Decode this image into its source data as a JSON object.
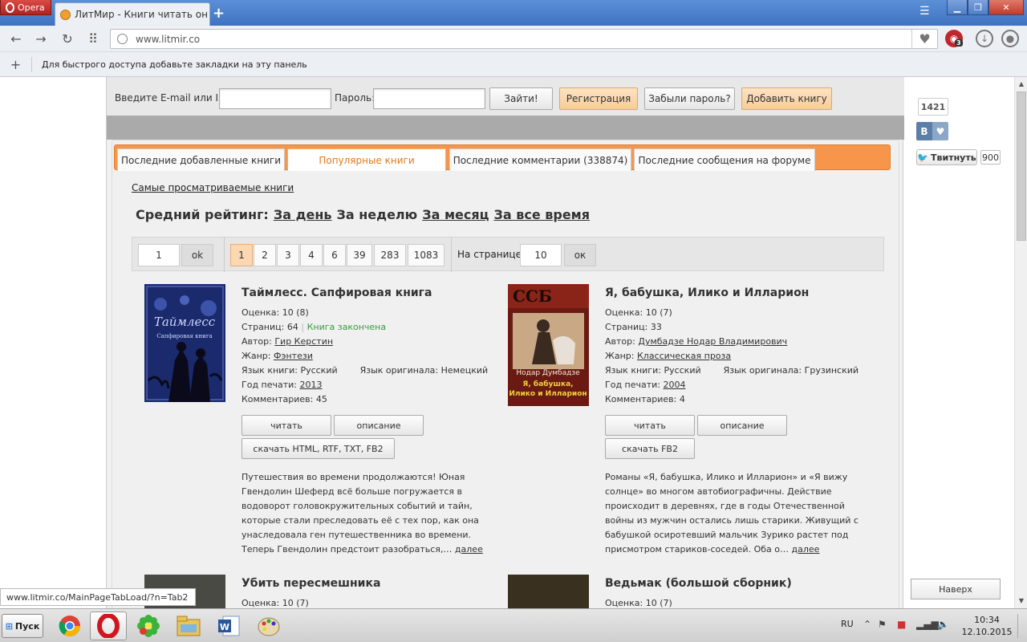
{
  "browser": {
    "menu_label": "Opera",
    "tab_title": "ЛитМир - Книги читать он",
    "url": "www.litmir.co",
    "adblock_count": "3",
    "bookmarks_hint": "Для быстрого доступа добавьте закладки на эту панель"
  },
  "login": {
    "email_label": "Введите E-mail или ID:",
    "password_label": "Пароль:",
    "login_button": "Зайти!",
    "register_button": "Регистрация",
    "forgot_button": "Забыли пароль?",
    "add_book_button": "Добавить книгу"
  },
  "tabs": [
    {
      "label": "Последние добавленные книги"
    },
    {
      "label": "Популярные книги"
    },
    {
      "label": "Последние комментарии (338874)"
    },
    {
      "label": "Последние сообщения на форуме"
    }
  ],
  "most_viewed_link": "Самые просматриваемые книги",
  "rating": {
    "label": "Средний рейтинг:",
    "links": [
      "За день",
      "За неделю",
      "За месяц",
      "За все время"
    ]
  },
  "pager": {
    "page_input": "1",
    "ok_label": "ok",
    "pages": [
      "1",
      "2",
      "3",
      "4",
      "6",
      "39",
      "283",
      "1083"
    ],
    "per_page_label": "На странице:",
    "per_page_value": "10",
    "per_page_ok": "ок"
  },
  "labels": {
    "rating": "Оценка:",
    "pages": "Страниц:",
    "author": "Автор:",
    "genre": "Жанр:",
    "lang": "Язык книги:",
    "orig_lang": "Язык оригинала:",
    "year": "Год печати:",
    "comments": "Комментариев:",
    "read": "читать",
    "description": "описание",
    "more": "далее"
  },
  "books": [
    {
      "title": "Таймлесс. Сапфировая книга",
      "rating": "10 (8)",
      "pages": "64",
      "status": "Книга закончена",
      "author": "Гир Керстин",
      "genre": "Фэнтези",
      "lang": "Русский",
      "orig_lang": "Немецкий",
      "year": "2013",
      "comments": "45",
      "download": "скачать HTML, RTF, TXT, FB2",
      "desc": "Путешествия во времени продолжаются! Юная Гвендолин Шеферд всё больше погружается в водоворот головокружительных событий и тайн, которые стали преследовать её с тех пор, как она унаследовала ген путешественника во времени. Теперь Гвендолин предстоит разобраться,…"
    },
    {
      "title": "Я, бабушка, Илико и Илларион",
      "rating": "10 (7)",
      "pages": "33",
      "author": "Думбадзе Нодар Владимирович",
      "genre": "Классическая проза",
      "lang": "Русский",
      "orig_lang": "Грузинский",
      "year": "2004",
      "comments": "4",
      "download": "скачать FB2",
      "desc": "Романы «Я, бабушка, Илико и Илларион» и «Я вижу солнце» во многом автобиографичны. Действие происходит в деревнях, где в годы Отечественной войны из мужчин остались лишь старики. Живущий с бабушкой осиротевший мальчик Зурико растет под присмотром стариков-соседей. Оба о…"
    },
    {
      "title": "Убить пересмешника",
      "rating": "10 (7)"
    },
    {
      "title": "Ведьмак (большой сборник)",
      "rating": "10 (7)"
    }
  ],
  "social": {
    "counter": "1421",
    "vk_label": "В",
    "tweet_label": "Твитнуть",
    "tweet_count": "900",
    "to_top": "Наверх"
  },
  "status_link": "www.litmir.co/MainPageTabLoad/?n=Tab2",
  "taskbar": {
    "start_label": "Пуск",
    "lang": "RU",
    "time": "10:34",
    "date": "12.10.2015"
  }
}
